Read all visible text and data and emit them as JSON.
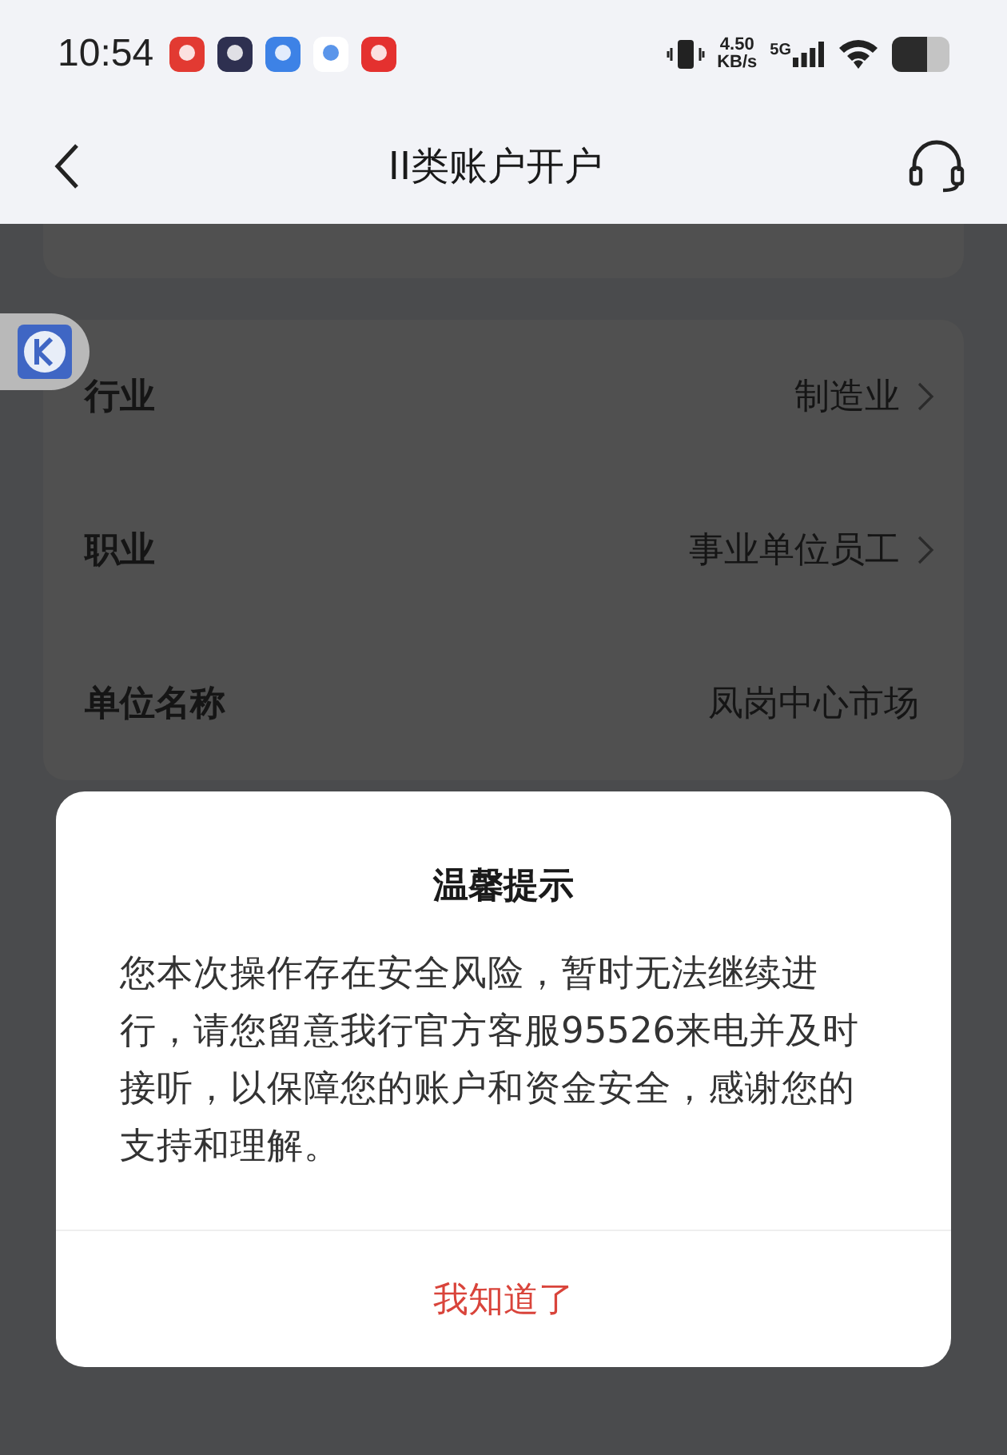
{
  "status_bar": {
    "time": "10:54",
    "net_speed": "4.50",
    "net_unit": "KB/s",
    "network": "5G"
  },
  "header": {
    "title": "II类账户开户"
  },
  "form": {
    "rows": [
      {
        "label": "行业",
        "value": "制造业",
        "chevron": true
      },
      {
        "label": "职业",
        "value": "事业单位员工",
        "chevron": true
      },
      {
        "label": "单位名称",
        "value": "凤岗中心市场",
        "chevron": false
      }
    ]
  },
  "dialog": {
    "title": "温馨提示",
    "message": "您本次操作存在安全风险，暂时无法继续进行，请您留意我行官方客服95526来电并及时接听，以保障您的账户和资金安全，感谢您的支持和理解。",
    "button": "我知道了"
  }
}
